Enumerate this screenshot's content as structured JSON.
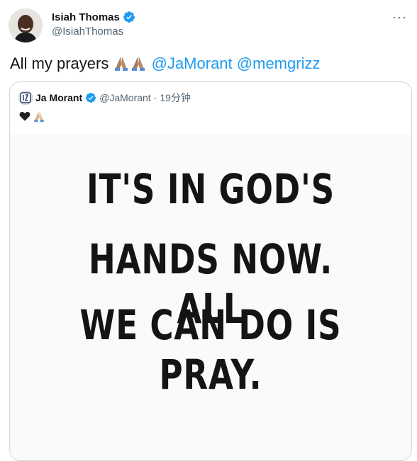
{
  "tweet": {
    "author_name": "Isiah Thomas",
    "author_handle": "@IsiahThomas",
    "more_label": "···",
    "text_prefix": "All my prayers",
    "mentions": [
      "@JaMorant",
      "@memgrizz"
    ],
    "verified_icon": "verified-badge-icon",
    "accent_color": "#1d9bf0"
  },
  "quote": {
    "author_name": "Ja Morant",
    "author_handle": "@JaMorant",
    "separator": "·",
    "time": "19分钟",
    "image_text": {
      "line1": "IT'S IN GOD'S",
      "line2": "HANDS NOW. ALL",
      "line3": "WE CAN DO IS PRAY."
    }
  }
}
